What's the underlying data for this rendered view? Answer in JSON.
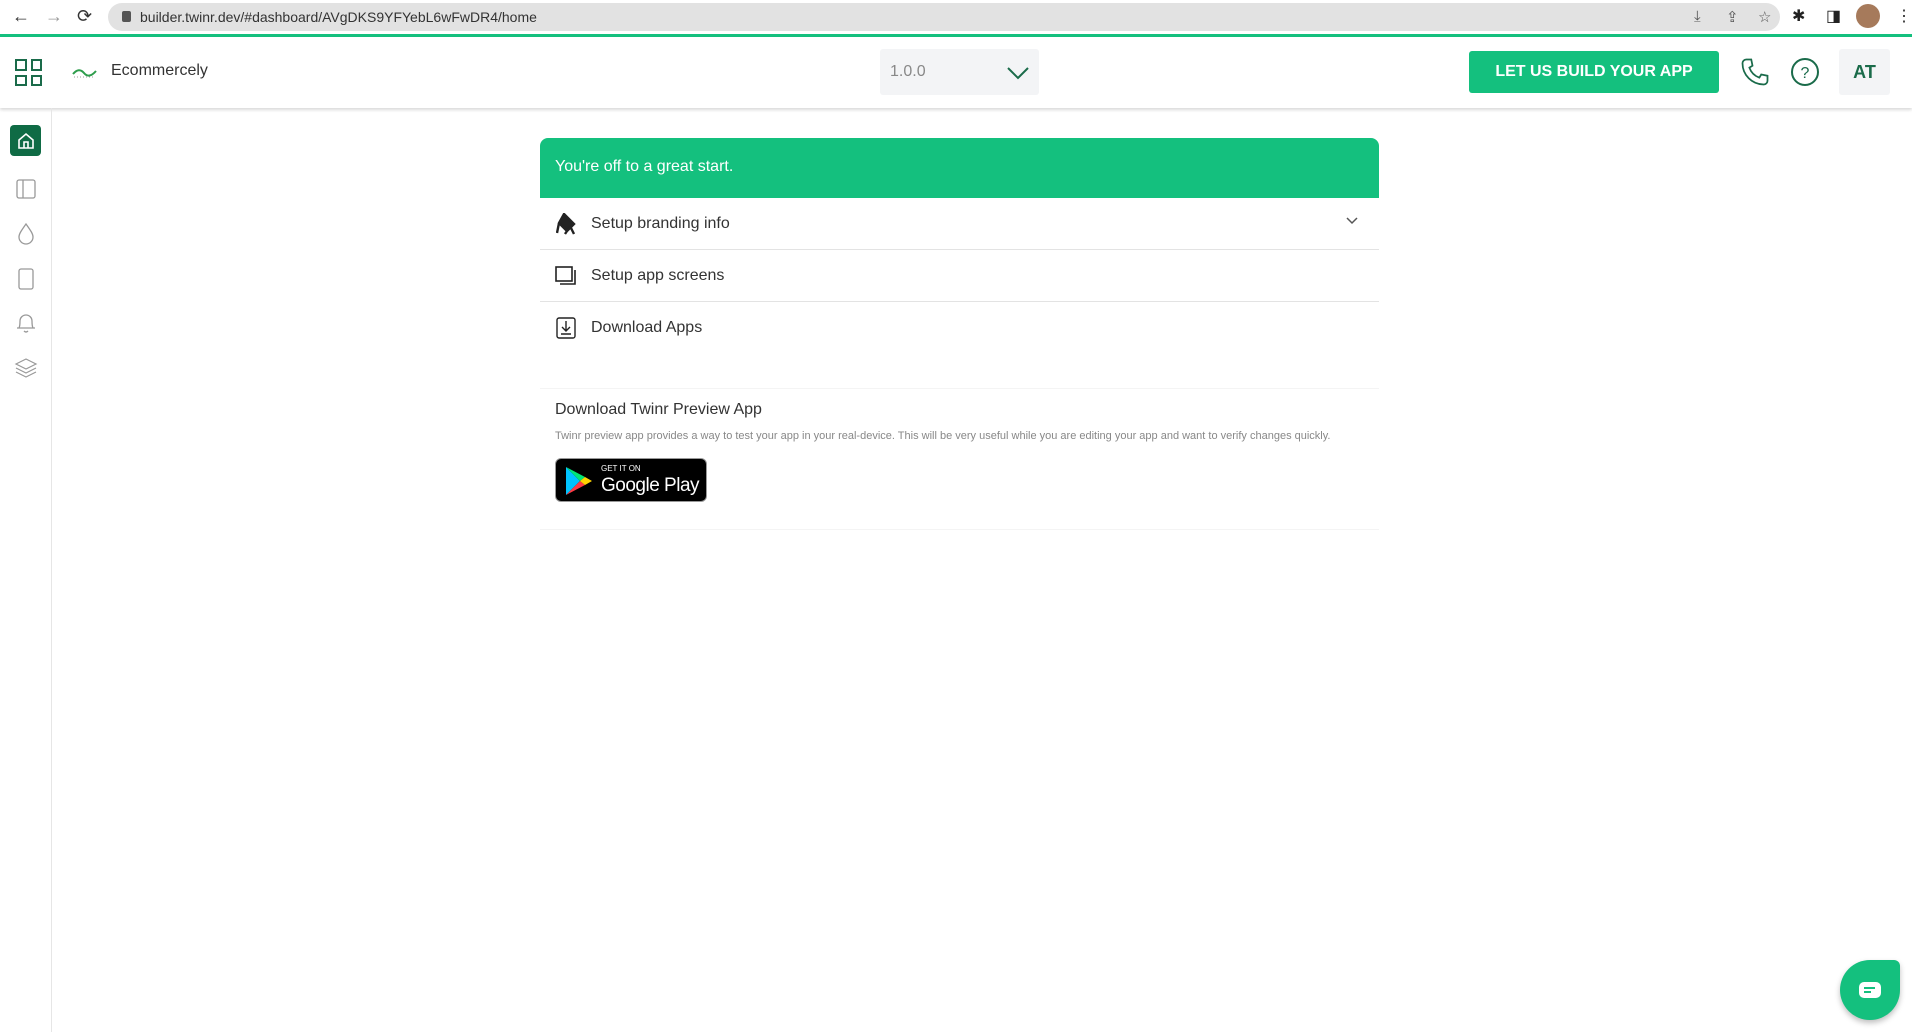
{
  "browser": {
    "url": "builder.twinr.dev/#dashboard/AVgDKS9YFYebL6wFwDR4/home"
  },
  "header": {
    "app_name": "Ecommercely",
    "version": "1.0.0",
    "cta_label": "LET US BUILD YOUR APP",
    "user_initials": "AT"
  },
  "sidebar": {
    "items": [
      {
        "icon": "home-icon",
        "active": true
      },
      {
        "icon": "layout-icon"
      },
      {
        "icon": "drop-icon"
      },
      {
        "icon": "device-icon"
      },
      {
        "icon": "bell-icon"
      },
      {
        "icon": "layers-icon"
      }
    ]
  },
  "onboarding": {
    "banner": "You're off to a great start.",
    "steps": [
      {
        "label": "Setup branding info",
        "icon": "paint-bucket-icon"
      },
      {
        "label": "Setup app screens",
        "icon": "screens-icon"
      },
      {
        "label": "Download Apps",
        "icon": "download-icon"
      }
    ]
  },
  "preview": {
    "title": "Download Twinr Preview App",
    "description": "Twinr preview app provides a way to test your app in your real-device. This will be very useful while you are editing your app and want to verify changes quickly.",
    "badge_small": "GET IT ON",
    "badge_large": "Google Play"
  },
  "colors": {
    "accent": "#14c07e",
    "dark_green": "#0f6b45"
  }
}
